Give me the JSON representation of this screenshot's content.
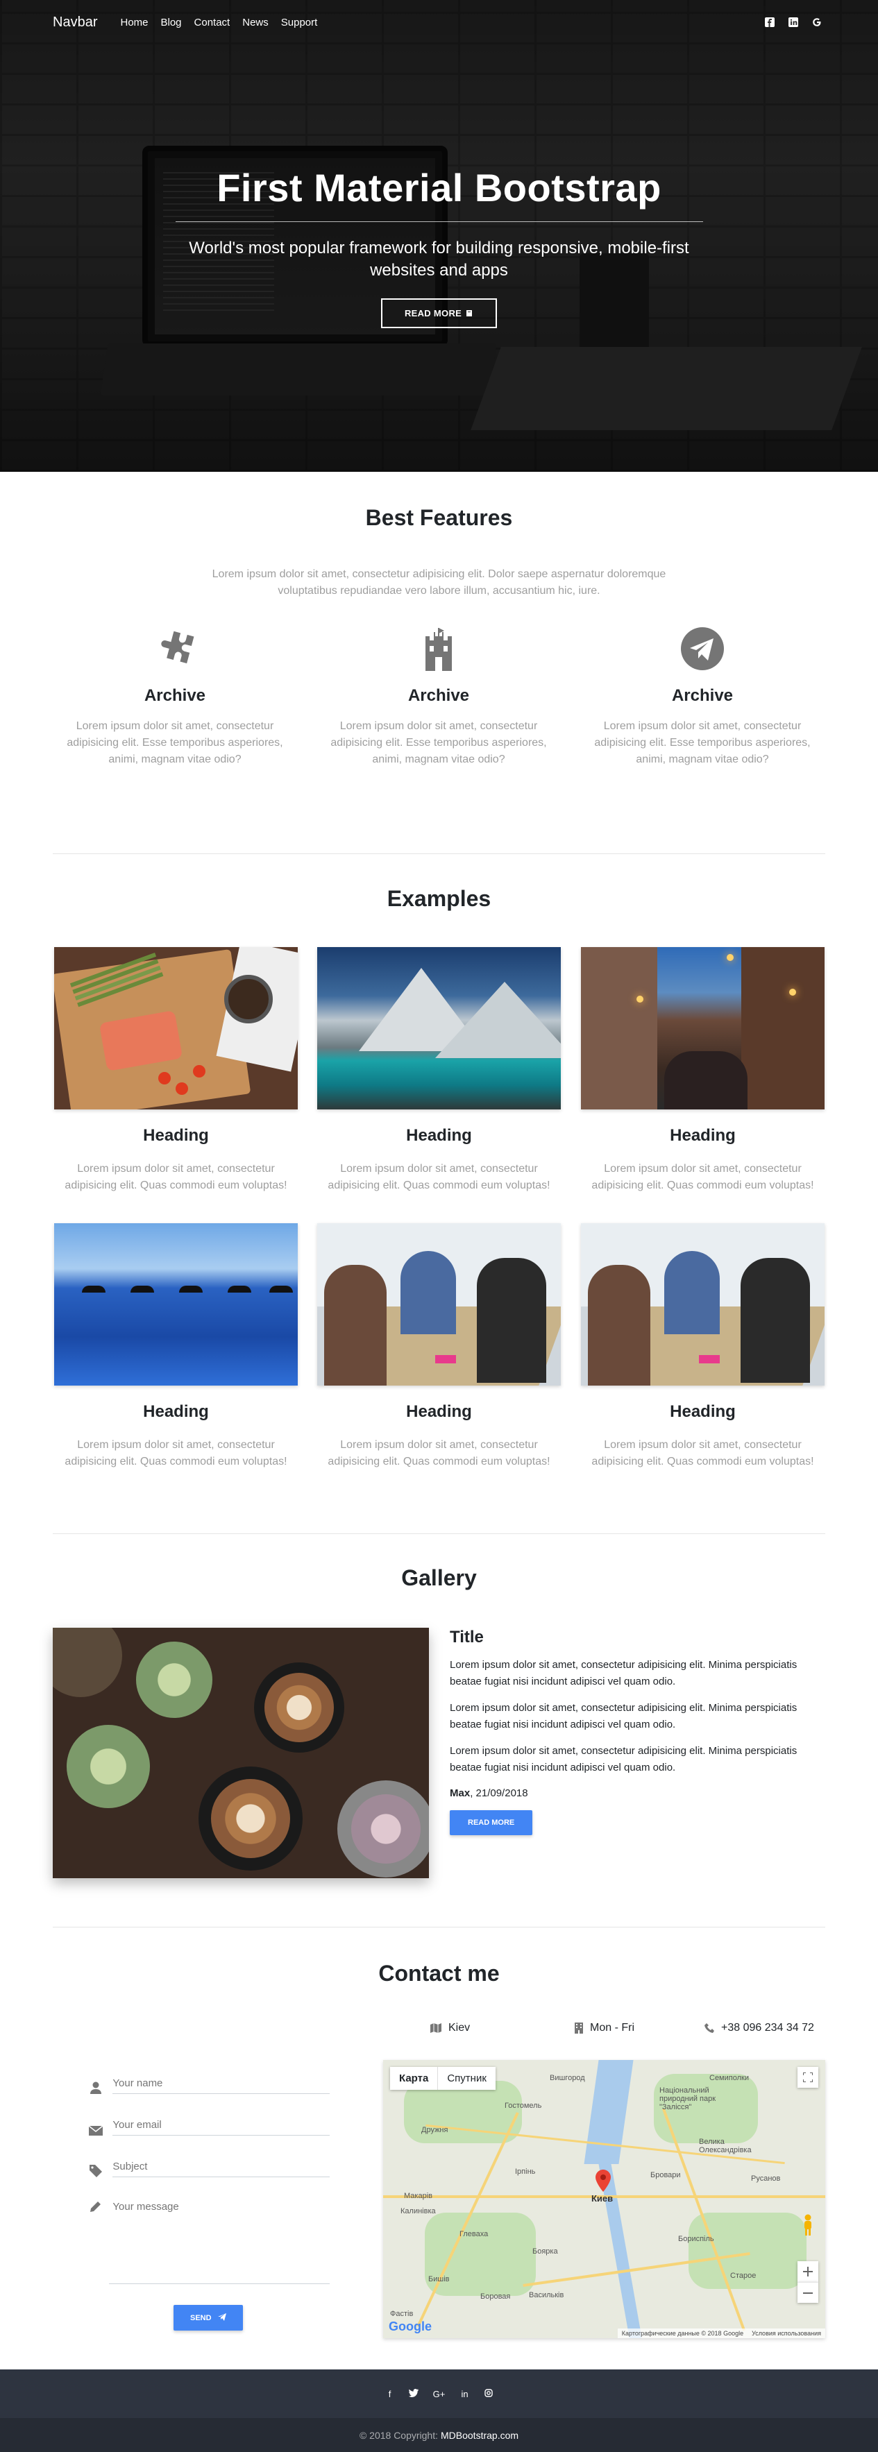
{
  "navbar": {
    "brand": "Navbar",
    "links": [
      "Home",
      "Blog",
      "Contact",
      "News",
      "Support"
    ],
    "icons": [
      "facebook-icon",
      "linkedin-icon",
      "google-icon"
    ]
  },
  "hero": {
    "title": "First Material Bootstrap",
    "subtitle": "World's most popular framework for building responsive, mobile-first websites and apps",
    "button": "READ MORE"
  },
  "features": {
    "title": "Best Features",
    "lead": "Lorem ipsum dolor sit amet, consectetur adipisicing elit. Dolor saepe aspernatur doloremque voluptatibus repudiandae vero labore illum, accusantium hic, iure.",
    "items": [
      {
        "icon": "puzzle-icon",
        "title": "Archive",
        "text": "Lorem ipsum dolor sit amet, consectetur adipisicing elit. Esse temporibus asperiores, animi, magnam vitae odio?"
      },
      {
        "icon": "castle-icon",
        "title": "Archive",
        "text": "Lorem ipsum dolor sit amet, consectetur adipisicing elit. Esse temporibus asperiores, animi, magnam vitae odio?"
      },
      {
        "icon": "paper-plane-icon",
        "title": "Archive",
        "text": "Lorem ipsum dolor sit amet, consectetur adipisicing elit. Esse temporibus asperiores, animi, magnam vitae odio?"
      }
    ]
  },
  "examples": {
    "title": "Examples",
    "cards": [
      {
        "title": "Heading",
        "text": "Lorem ipsum dolor sit amet, consectetur adipisicing elit. Quas commodi eum voluptas!"
      },
      {
        "title": "Heading",
        "text": "Lorem ipsum dolor sit amet, consectetur adipisicing elit. Quas commodi eum voluptas!"
      },
      {
        "title": "Heading",
        "text": "Lorem ipsum dolor sit amet, consectetur adipisicing elit. Quas commodi eum voluptas!"
      },
      {
        "title": "Heading",
        "text": "Lorem ipsum dolor sit amet, consectetur adipisicing elit. Quas commodi eum voluptas!"
      },
      {
        "title": "Heading",
        "text": "Lorem ipsum dolor sit amet, consectetur adipisicing elit. Quas commodi eum voluptas!"
      },
      {
        "title": "Heading",
        "text": "Lorem ipsum dolor sit amet, consectetur adipisicing elit. Quas commodi eum voluptas!"
      }
    ]
  },
  "gallery": {
    "title": "Gallery",
    "item_title": "Title",
    "paragraphs": [
      "Lorem ipsum dolor sit amet, consectetur adipisicing elit. Minima perspiciatis beatae fugiat nisi incidunt adipisci vel quam odio.",
      "Lorem ipsum dolor sit amet, consectetur adipisicing elit. Minima perspiciatis beatae fugiat nisi incidunt adipisci vel quam odio.",
      "Lorem ipsum dolor sit amet, consectetur adipisicing elit. Minima perspiciatis beatae fugiat nisi incidunt adipisci vel quam odio."
    ],
    "author": "Max",
    "date": ", 21/09/2018",
    "button": "READ MORE"
  },
  "contact": {
    "title": "Contact me",
    "city": "Kiev",
    "hours": "Mon - Fri",
    "phone": "+38 096 234 34 72",
    "fields": {
      "name": "Your name",
      "email": "Your email",
      "subject": "Subject",
      "message": "Your message"
    },
    "send": "SEND"
  },
  "map": {
    "tab_map": "Карта",
    "tab_satellite": "Спутник",
    "city_label": "Киев",
    "towns": [
      "Дружня",
      "Ірпінь",
      "Бровари",
      "Макарів",
      "Калинівка",
      "Боярка",
      "Бориспіль",
      "Бишів",
      "Боровая",
      "Васильків",
      "Старое",
      "Русанов",
      "Велика Олександрівка",
      "Семиполки",
      "Національний природний парк \"Залісся\"",
      "Гостомель",
      "Вишгород",
      "Фастів",
      "Глеваха"
    ],
    "attribution": "Картографические данные © 2018 Google",
    "terms": "Условия использования",
    "logo": "Google"
  },
  "footer": {
    "copyright": "© 2018 Copyright:",
    "link": "MDBootstrap.com",
    "social": [
      "facebook-icon",
      "twitter-icon",
      "google-plus-icon",
      "linkedin-icon",
      "instagram-icon"
    ]
  },
  "colors": {
    "primary": "#4285f4",
    "footer": "#2e3440",
    "footer_bottom": "#262b34",
    "muted_text": "#9e9e9e"
  }
}
